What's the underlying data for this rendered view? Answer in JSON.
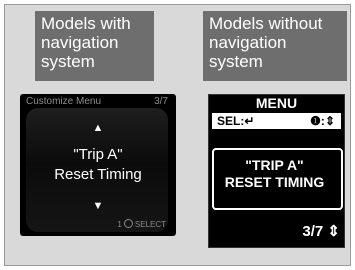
{
  "captions": {
    "left": "Models with\nnavigation\nsystem",
    "right": "Models without\nnavigation\nsystem"
  },
  "nav_screen": {
    "header_title": "Customize Menu",
    "header_page": "3/7",
    "up_arrow": "▲",
    "line1": "\"Trip A\"",
    "line2": "Reset Timing",
    "down_arrow": "▼",
    "footer_label": "SELECT",
    "footer_prefix": "1"
  },
  "mid_screen": {
    "title": "MENU",
    "sel_label": "SEL:",
    "sel_icon": "↵",
    "info_label": "❶:",
    "info_icon": "⇕",
    "line1": "\"TRIP A\"",
    "line2": "RESET TIMING",
    "page": "3/7",
    "page_icon": "⇕"
  }
}
